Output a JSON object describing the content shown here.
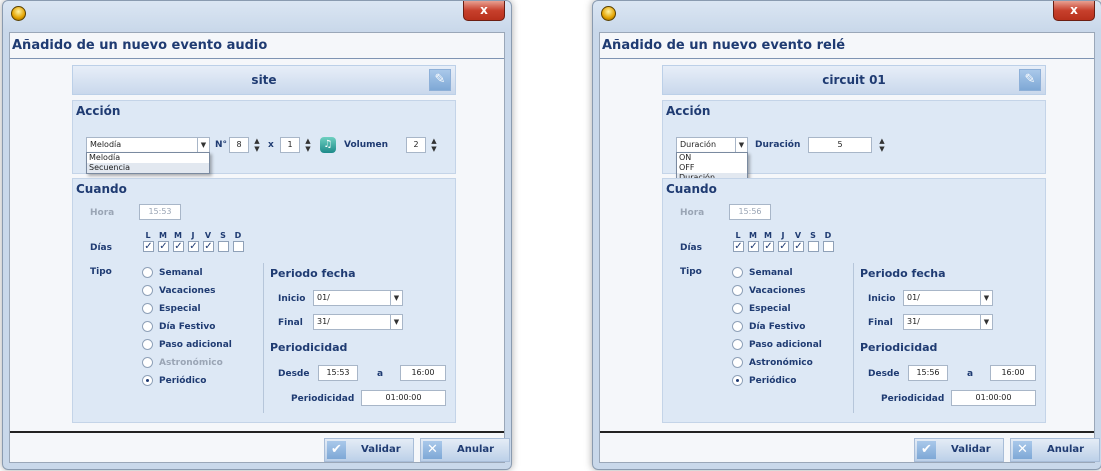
{
  "windows": [
    {
      "title": "Añadido de un nuevo evento audio",
      "close_label": "x",
      "name_field": "site",
      "accion": {
        "header": "Acción",
        "select_value": "Melodía",
        "dropdown_options": [
          "Melodía",
          "Secuencia"
        ],
        "n_label": "N°",
        "n_value": "8",
        "x_label": "x",
        "x_value": "1",
        "volumen_label": "Volumen",
        "volumen_value": "2"
      },
      "cuando": {
        "header": "Cuando",
        "hora_label": "Hora",
        "hora_value": "15:53",
        "dias_label": "Días",
        "days": [
          "L",
          "M",
          "M",
          "J",
          "V",
          "S",
          "D"
        ],
        "days_checked": [
          true,
          true,
          true,
          true,
          true,
          false,
          false
        ],
        "tipo_label": "Tipo",
        "tipo_options": [
          "Semanal",
          "Vacaciones",
          "Especial",
          "Día Festivo",
          "Paso adicional",
          "Astronómico",
          "Periódico"
        ],
        "tipo_selected": 6,
        "tipo_disabled": [
          5
        ],
        "periodo_fecha": "Periodo fecha",
        "inicio_label": "Inicio",
        "inicio_value": "01/",
        "final_label": "Final",
        "final_value": "31/",
        "periodicidad_header": "Periodicidad",
        "desde_label": "Desde",
        "desde_value": "15:53",
        "a_label": "a",
        "a_value": "16:00",
        "periodicidad_label": "Periodicidad",
        "periodicidad_value": "01:00:00"
      },
      "buttons": {
        "validar": "Validar",
        "anular": "Anular"
      }
    },
    {
      "title": "Añadido de un nuevo evento relé",
      "close_label": "x",
      "name_field": "circuit 01",
      "accion": {
        "header": "Acción",
        "select_value": "Duración",
        "dropdown_options": [
          "ON",
          "OFF",
          "Duración"
        ],
        "duracion_label": "Duración",
        "duracion_value": "5"
      },
      "cuando": {
        "header": "Cuando",
        "hora_label": "Hora",
        "hora_value": "15:56",
        "dias_label": "Días",
        "days": [
          "L",
          "M",
          "M",
          "J",
          "V",
          "S",
          "D"
        ],
        "days_checked": [
          true,
          true,
          true,
          true,
          true,
          false,
          false
        ],
        "tipo_label": "Tipo",
        "tipo_options": [
          "Semanal",
          "Vacaciones",
          "Especial",
          "Día Festivo",
          "Paso adicional",
          "Astronómico",
          "Periódico"
        ],
        "tipo_selected": 6,
        "tipo_disabled": [],
        "periodo_fecha": "Periodo fecha",
        "inicio_label": "Inicio",
        "inicio_value": "01/",
        "final_label": "Final",
        "final_value": "31/",
        "periodicidad_header": "Periodicidad",
        "desde_label": "Desde",
        "desde_value": "15:56",
        "a_label": "a",
        "a_value": "16:00",
        "periodicidad_label": "Periodicidad",
        "periodicidad_value": "01:00:00"
      },
      "buttons": {
        "validar": "Validar",
        "anular": "Anular"
      }
    }
  ]
}
